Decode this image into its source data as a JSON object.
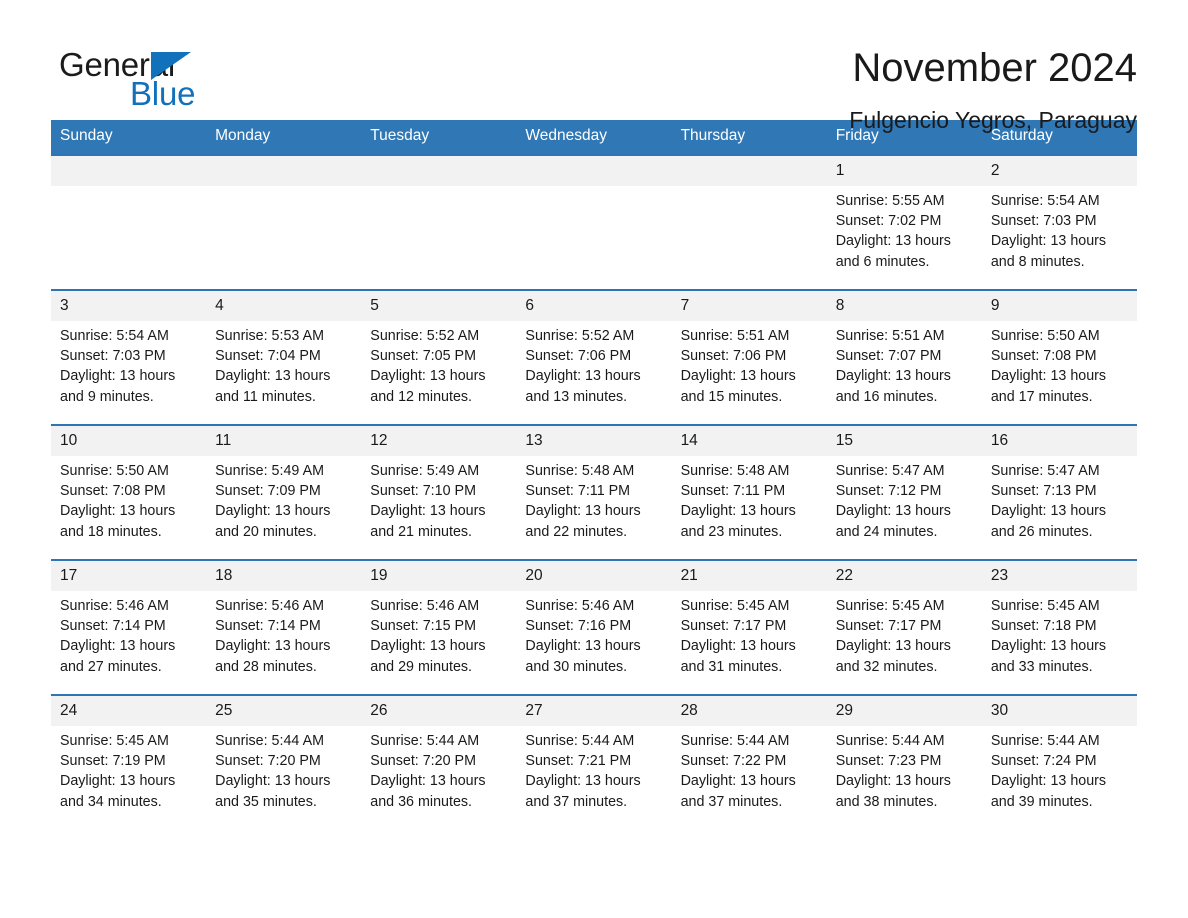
{
  "brand": {
    "name_part1": "General",
    "name_part2": "Blue",
    "accent_color": "#1271bb"
  },
  "header": {
    "title": "November 2024",
    "subtitle": "Fulgencio Yegros, Paraguay"
  },
  "calendar": {
    "header_bg": "#3077b5",
    "row_border_color": "#2e75b6",
    "daynum_bg": "#f2f2f2",
    "weekdays": [
      "Sunday",
      "Monday",
      "Tuesday",
      "Wednesday",
      "Thursday",
      "Friday",
      "Saturday"
    ],
    "weeks": [
      [
        {
          "day": "",
          "lines": []
        },
        {
          "day": "",
          "lines": []
        },
        {
          "day": "",
          "lines": []
        },
        {
          "day": "",
          "lines": []
        },
        {
          "day": "",
          "lines": []
        },
        {
          "day": "1",
          "lines": [
            "Sunrise: 5:55 AM",
            "Sunset: 7:02 PM",
            "Daylight: 13 hours",
            "and 6 minutes."
          ]
        },
        {
          "day": "2",
          "lines": [
            "Sunrise: 5:54 AM",
            "Sunset: 7:03 PM",
            "Daylight: 13 hours",
            "and 8 minutes."
          ]
        }
      ],
      [
        {
          "day": "3",
          "lines": [
            "Sunrise: 5:54 AM",
            "Sunset: 7:03 PM",
            "Daylight: 13 hours",
            "and 9 minutes."
          ]
        },
        {
          "day": "4",
          "lines": [
            "Sunrise: 5:53 AM",
            "Sunset: 7:04 PM",
            "Daylight: 13 hours",
            "and 11 minutes."
          ]
        },
        {
          "day": "5",
          "lines": [
            "Sunrise: 5:52 AM",
            "Sunset: 7:05 PM",
            "Daylight: 13 hours",
            "and 12 minutes."
          ]
        },
        {
          "day": "6",
          "lines": [
            "Sunrise: 5:52 AM",
            "Sunset: 7:06 PM",
            "Daylight: 13 hours",
            "and 13 minutes."
          ]
        },
        {
          "day": "7",
          "lines": [
            "Sunrise: 5:51 AM",
            "Sunset: 7:06 PM",
            "Daylight: 13 hours",
            "and 15 minutes."
          ]
        },
        {
          "day": "8",
          "lines": [
            "Sunrise: 5:51 AM",
            "Sunset: 7:07 PM",
            "Daylight: 13 hours",
            "and 16 minutes."
          ]
        },
        {
          "day": "9",
          "lines": [
            "Sunrise: 5:50 AM",
            "Sunset: 7:08 PM",
            "Daylight: 13 hours",
            "and 17 minutes."
          ]
        }
      ],
      [
        {
          "day": "10",
          "lines": [
            "Sunrise: 5:50 AM",
            "Sunset: 7:08 PM",
            "Daylight: 13 hours",
            "and 18 minutes."
          ]
        },
        {
          "day": "11",
          "lines": [
            "Sunrise: 5:49 AM",
            "Sunset: 7:09 PM",
            "Daylight: 13 hours",
            "and 20 minutes."
          ]
        },
        {
          "day": "12",
          "lines": [
            "Sunrise: 5:49 AM",
            "Sunset: 7:10 PM",
            "Daylight: 13 hours",
            "and 21 minutes."
          ]
        },
        {
          "day": "13",
          "lines": [
            "Sunrise: 5:48 AM",
            "Sunset: 7:11 PM",
            "Daylight: 13 hours",
            "and 22 minutes."
          ]
        },
        {
          "day": "14",
          "lines": [
            "Sunrise: 5:48 AM",
            "Sunset: 7:11 PM",
            "Daylight: 13 hours",
            "and 23 minutes."
          ]
        },
        {
          "day": "15",
          "lines": [
            "Sunrise: 5:47 AM",
            "Sunset: 7:12 PM",
            "Daylight: 13 hours",
            "and 24 minutes."
          ]
        },
        {
          "day": "16",
          "lines": [
            "Sunrise: 5:47 AM",
            "Sunset: 7:13 PM",
            "Daylight: 13 hours",
            "and 26 minutes."
          ]
        }
      ],
      [
        {
          "day": "17",
          "lines": [
            "Sunrise: 5:46 AM",
            "Sunset: 7:14 PM",
            "Daylight: 13 hours",
            "and 27 minutes."
          ]
        },
        {
          "day": "18",
          "lines": [
            "Sunrise: 5:46 AM",
            "Sunset: 7:14 PM",
            "Daylight: 13 hours",
            "and 28 minutes."
          ]
        },
        {
          "day": "19",
          "lines": [
            "Sunrise: 5:46 AM",
            "Sunset: 7:15 PM",
            "Daylight: 13 hours",
            "and 29 minutes."
          ]
        },
        {
          "day": "20",
          "lines": [
            "Sunrise: 5:46 AM",
            "Sunset: 7:16 PM",
            "Daylight: 13 hours",
            "and 30 minutes."
          ]
        },
        {
          "day": "21",
          "lines": [
            "Sunrise: 5:45 AM",
            "Sunset: 7:17 PM",
            "Daylight: 13 hours",
            "and 31 minutes."
          ]
        },
        {
          "day": "22",
          "lines": [
            "Sunrise: 5:45 AM",
            "Sunset: 7:17 PM",
            "Daylight: 13 hours",
            "and 32 minutes."
          ]
        },
        {
          "day": "23",
          "lines": [
            "Sunrise: 5:45 AM",
            "Sunset: 7:18 PM",
            "Daylight: 13 hours",
            "and 33 minutes."
          ]
        }
      ],
      [
        {
          "day": "24",
          "lines": [
            "Sunrise: 5:45 AM",
            "Sunset: 7:19 PM",
            "Daylight: 13 hours",
            "and 34 minutes."
          ]
        },
        {
          "day": "25",
          "lines": [
            "Sunrise: 5:44 AM",
            "Sunset: 7:20 PM",
            "Daylight: 13 hours",
            "and 35 minutes."
          ]
        },
        {
          "day": "26",
          "lines": [
            "Sunrise: 5:44 AM",
            "Sunset: 7:20 PM",
            "Daylight: 13 hours",
            "and 36 minutes."
          ]
        },
        {
          "day": "27",
          "lines": [
            "Sunrise: 5:44 AM",
            "Sunset: 7:21 PM",
            "Daylight: 13 hours",
            "and 37 minutes."
          ]
        },
        {
          "day": "28",
          "lines": [
            "Sunrise: 5:44 AM",
            "Sunset: 7:22 PM",
            "Daylight: 13 hours",
            "and 37 minutes."
          ]
        },
        {
          "day": "29",
          "lines": [
            "Sunrise: 5:44 AM",
            "Sunset: 7:23 PM",
            "Daylight: 13 hours",
            "and 38 minutes."
          ]
        },
        {
          "day": "30",
          "lines": [
            "Sunrise: 5:44 AM",
            "Sunset: 7:24 PM",
            "Daylight: 13 hours",
            "and 39 minutes."
          ]
        }
      ]
    ]
  }
}
